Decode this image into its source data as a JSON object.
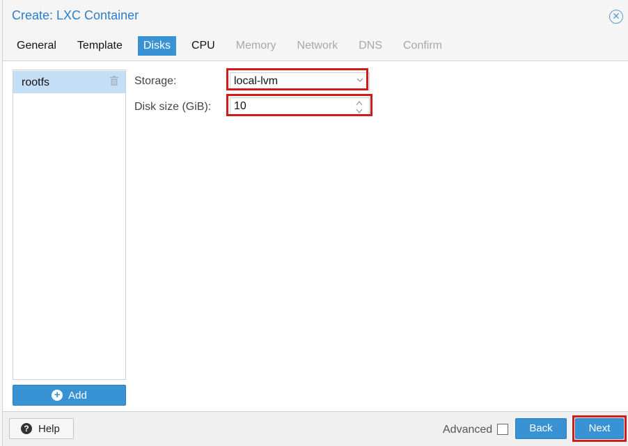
{
  "window": {
    "title": "Create: LXC Container",
    "close_icon": "close-circle-icon"
  },
  "tabs": [
    {
      "label": "General",
      "state": "normal"
    },
    {
      "label": "Template",
      "state": "normal"
    },
    {
      "label": "Disks",
      "state": "active"
    },
    {
      "label": "CPU",
      "state": "normal"
    },
    {
      "label": "Memory",
      "state": "disabled"
    },
    {
      "label": "Network",
      "state": "disabled"
    },
    {
      "label": "DNS",
      "state": "disabled"
    },
    {
      "label": "Confirm",
      "state": "disabled"
    }
  ],
  "disk_list": {
    "items": [
      {
        "label": "rootfs",
        "selected": true
      }
    ],
    "add_label": "Add",
    "delete_icon": "trash-icon",
    "add_icon": "plus-circle-icon"
  },
  "form": {
    "storage_label": "Storage:",
    "storage_value": "local-lvm",
    "disk_size_label": "Disk size (GiB):",
    "disk_size_value": "10"
  },
  "footer": {
    "help_label": "Help",
    "advanced_label": "Advanced",
    "advanced_checked": false,
    "back_label": "Back",
    "next_label": "Next"
  },
  "colors": {
    "accent": "#3892d4",
    "title": "#2b7ec9",
    "highlight": "#d11a1a",
    "selection": "#c4dff5"
  }
}
